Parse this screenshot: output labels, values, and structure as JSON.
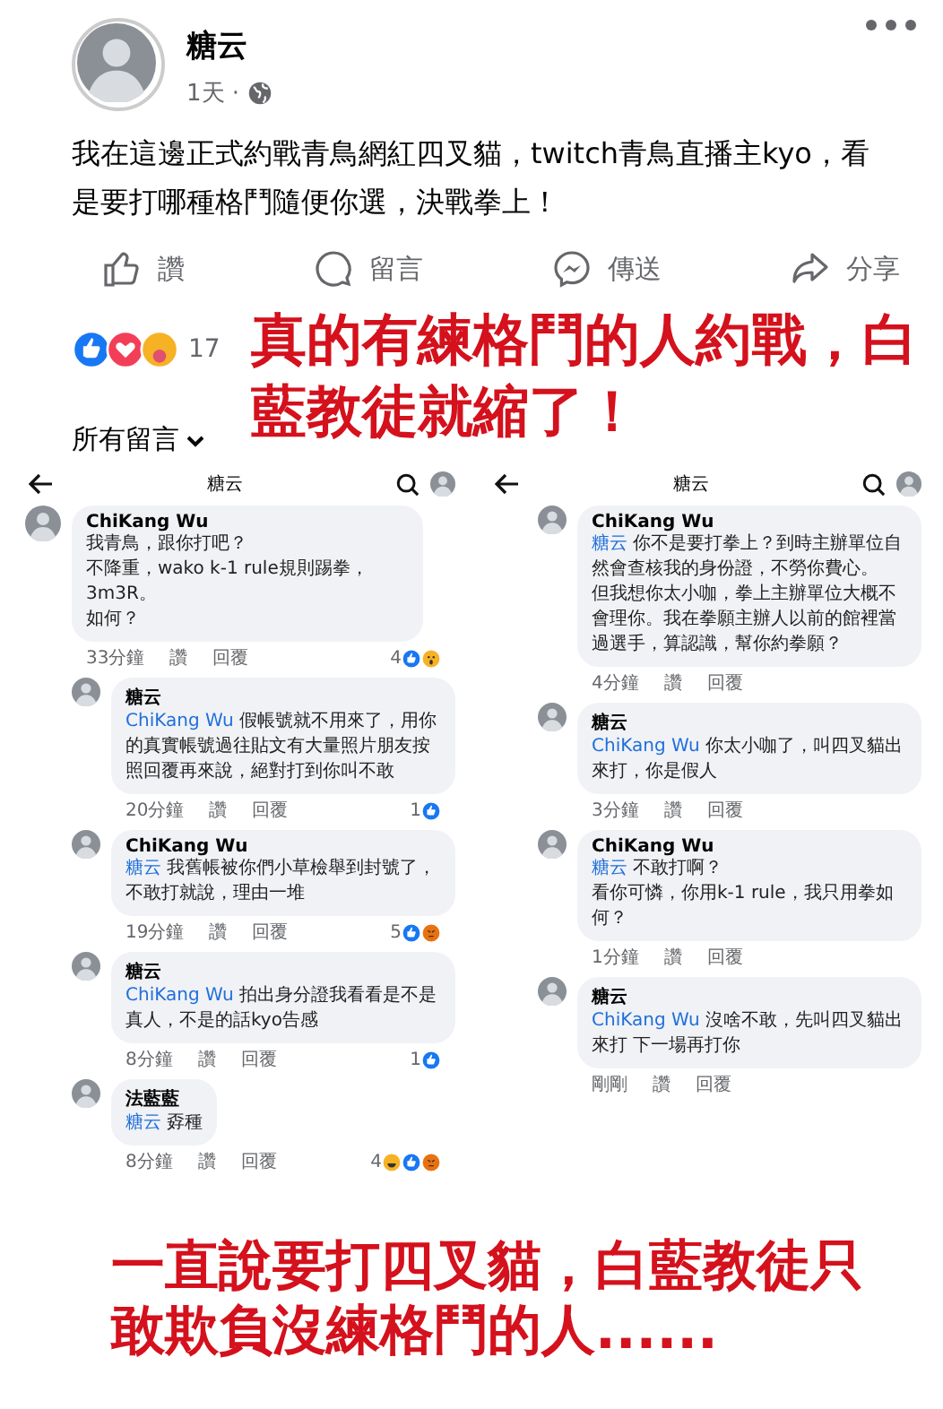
{
  "post": {
    "author": "糖云",
    "time": "1天 ·",
    "text": "我在這邊正式約戰青鳥網紅四叉貓，twitch青鳥直播主kyo，看是要打哪種格鬥隨便你選，決戰拳上！",
    "actions": [
      {
        "kind": "like",
        "label": "讚"
      },
      {
        "kind": "comment",
        "label": "留言"
      },
      {
        "kind": "send",
        "label": "傳送"
      },
      {
        "kind": "share",
        "label": "分享"
      }
    ],
    "reactions": [
      {
        "kind": "like"
      },
      {
        "kind": "love"
      },
      {
        "kind": "care"
      }
    ],
    "reaction_count": "17",
    "comment_filter": "所有留言"
  },
  "caption_top": "真的有練格鬥的人約戰，白藍教徒就縮了！",
  "screenshots": [
    {
      "title": "糖云",
      "comments": [
        {
          "name": "ChiKang Wu",
          "lines": [
            "我青鳥，跟你打吧？",
            "不降重，wako k-1 rule規則踢拳，3m3R。",
            "如何？"
          ],
          "time": "33分鐘",
          "like": "讚",
          "reply": "回覆",
          "count": "4",
          "reactions": [
            {
              "kind": "like"
            },
            {
              "kind": "wow"
            }
          ],
          "replies": [
            {
              "name": "糖云",
              "mention": "ChiKang Wu",
              "lines": [
                "假帳號就不用來了，用你的真實帳號過往貼文有大量照片朋友按照回覆再來說，絕對打到你叫不敢"
              ],
              "time": "20分鐘",
              "like": "讚",
              "reply": "回覆",
              "count": "1",
              "reactions": [
                {
                  "kind": "like"
                }
              ]
            },
            {
              "name": "ChiKang Wu",
              "mention": "糖云",
              "lines": [
                "我舊帳被你們小草檢舉到封號了，不敢打就說，理由一堆"
              ],
              "time": "19分鐘",
              "like": "讚",
              "reply": "回覆",
              "count": "5",
              "reactions": [
                {
                  "kind": "like"
                },
                {
                  "kind": "angry"
                }
              ]
            },
            {
              "name": "糖云",
              "mention": "ChiKang Wu",
              "lines": [
                "拍出身分證我看看是不是真人，不是的話kyo告感"
              ],
              "time": "8分鐘",
              "like": "讚",
              "reply": "回覆",
              "count": "1",
              "reactions": [
                {
                  "kind": "like"
                }
              ]
            },
            {
              "name": "法藍藍",
              "mention": "糖云",
              "lines": [
                "孬種"
              ],
              "time": "8分鐘",
              "like": "讚",
              "reply": "回覆",
              "count": "4",
              "reactions": [
                {
                  "kind": "haha"
                },
                {
                  "kind": "like"
                },
                {
                  "kind": "angry"
                }
              ]
            }
          ]
        }
      ]
    },
    {
      "title": "糖云",
      "replies": [
        {
          "name": "ChiKang Wu",
          "mention": "糖云",
          "lines": [
            "你不是要打拳上？到時主辦單位自然會查核我的身份證，不勞你費心。",
            "但我想你太小咖，拳上主辦單位大概不會理你。我在拳願主辦人以前的館裡當過選手，算認識，幫你約拳願？"
          ],
          "time": "4分鐘",
          "like": "讚",
          "reply": "回覆"
        },
        {
          "name": "糖云",
          "mention": "ChiKang Wu",
          "lines": [
            "你太小咖了，叫四叉貓出來打，你是假人"
          ],
          "time": "3分鐘",
          "like": "讚",
          "reply": "回覆"
        },
        {
          "name": "ChiKang Wu",
          "mention": "糖云",
          "lines": [
            "不敢打啊？",
            "看你可憐，你用k-1 rule，我只用拳如何？"
          ],
          "time": "1分鐘",
          "like": "讚",
          "reply": "回覆"
        },
        {
          "name": "糖云",
          "mention": "ChiKang Wu",
          "lines": [
            "沒啥不敢，先叫四叉貓出來打 下一場再打你"
          ],
          "time": "剛剛",
          "like": "讚",
          "reply": "回覆"
        }
      ]
    }
  ],
  "caption_bottom": "一直說要打四叉貓，白藍教徒只敢欺負沒練格鬥的人......"
}
